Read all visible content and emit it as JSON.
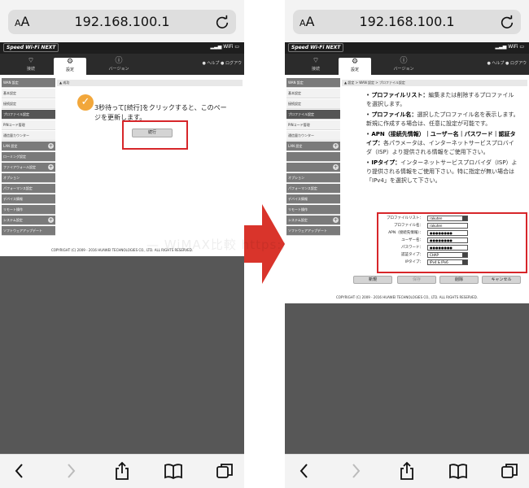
{
  "safari": {
    "aa_label": "AA",
    "url": "192.168.100.1"
  },
  "router": {
    "brand": "Speed Wi-Fi NEXT",
    "status_wifi": "WiFi",
    "tabs": [
      {
        "label": "接続",
        "icon": "wifi-icon"
      },
      {
        "label": "設定",
        "icon": "gear-icon"
      },
      {
        "label": "バージョン",
        "icon": "info-icon"
      }
    ],
    "help_label": "ヘルプ",
    "logout_label": "ログアウ",
    "copyright": "COPYRIGHT (C) 2009 - 2016 HUAWEI TECHNOLOGIES CO., LTD. ALL RIGHTS RESERVED."
  },
  "left_screen": {
    "menu_items": [
      "WAN 設定",
      "基本設定",
      "接続設定",
      "プロファイル設定",
      "PINコード管理",
      "通信量カウンター",
      "LAN 設定",
      "ローミング設定",
      "ファイアウォール設定",
      "オプション",
      "パフォーマンス設定",
      "デバイス情報",
      "リモート操作",
      "システム設定",
      "ソフトウェアアップデート"
    ],
    "content_head": "成功",
    "message": "3秒待って[続行]をクリックすると、このページを更新します。",
    "continue_button": "続行"
  },
  "right_screen": {
    "menu_items": [
      "WAN 設定",
      "基本設定",
      "接続設定",
      "プロファイル設定",
      "PINコード管理",
      "通信量カウンター",
      "LAN 設定",
      "",
      "",
      "オプション",
      "パフォーマンス設定",
      "デバイス情報",
      "リモート操作",
      "システム設定",
      "ソフトウェアアップデート"
    ],
    "breadcrumb": "設定 > WAN 設定 > プロファイル設定",
    "bullets": [
      {
        "title": "プロファイルリスト：",
        "text": "編集または削除するプロファイルを選択します。"
      },
      {
        "title": "プロファイル名：",
        "text": "選択したプロファイル名を表示します。新規に作成する場合は、任意に設定が可能です。"
      },
      {
        "title": "APN（接続先情報）｜ユーザー名｜パスワード｜認証タイプ：",
        "text": "各パラメータは、インターネットサービスプロバイダ（ISP）より提供される情報をご使用下さい。"
      },
      {
        "title": "IPタイプ：",
        "text": "インターネットサービスプロバイダ（ISP）より提供される情報をご使用下さい。特に指定が無い場合は「IPv4」を選択して下さい。"
      }
    ],
    "form": [
      {
        "label": "プロファイルリスト：",
        "value": "rakuten",
        "type": "select"
      },
      {
        "label": "プロファイル名：",
        "value": "rakuten",
        "type": "text"
      },
      {
        "label": "APN（接続先情報）：",
        "value": "●●●●●●●●",
        "type": "text"
      },
      {
        "label": "ユーザー名：",
        "value": "●●●●●●●●",
        "type": "text"
      },
      {
        "label": "パスワード：",
        "value": "●●●●●●●●",
        "type": "text"
      },
      {
        "label": "認証タイプ：",
        "value": "CHAP",
        "type": "select"
      },
      {
        "label": "IPタイプ：",
        "value": "IPv4 & IPv6",
        "type": "select"
      }
    ],
    "buttons": {
      "new": "新規",
      "save": "保存",
      "delete": "削除",
      "cancel": "キャンセル"
    }
  },
  "watermark": "— WiMAX比較  https://mimomori.com"
}
